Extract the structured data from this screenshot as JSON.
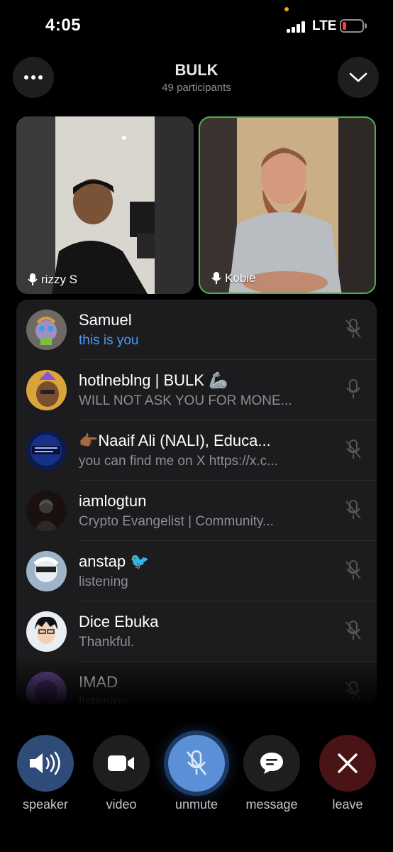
{
  "status_bar": {
    "time": "4:05",
    "network": "LTE"
  },
  "header": {
    "title": "BULK",
    "subtitle": "49 participants"
  },
  "video_tiles": [
    {
      "name": "rizzy S"
    },
    {
      "name": "Kobie"
    }
  ],
  "participants": [
    {
      "name": "Samuel",
      "status": "this is you"
    },
    {
      "name": "hotlneblng | BULK 🦾",
      "status": "WILL NOT ASK YOU FOR MONE..."
    },
    {
      "name": "👉🏾Naaif Ali (NALI), Educa...",
      "status": "you can find me on X https://x.c..."
    },
    {
      "name": "iamlogtun",
      "status": "Crypto Evangelist | Community..."
    },
    {
      "name": "anstap 🐦",
      "status": "listening"
    },
    {
      "name": "Dice Ebuka",
      "status": "Thankful."
    },
    {
      "name": "IMAD",
      "status": "listening"
    }
  ],
  "controls": {
    "speaker": "speaker",
    "video": "video",
    "unmute": "unmute",
    "message": "message",
    "leave": "leave"
  },
  "colors": {
    "accent_blue": "#4a9bf5",
    "active_speaker_border": "#4caf50",
    "leave_red": "#4a1416"
  }
}
